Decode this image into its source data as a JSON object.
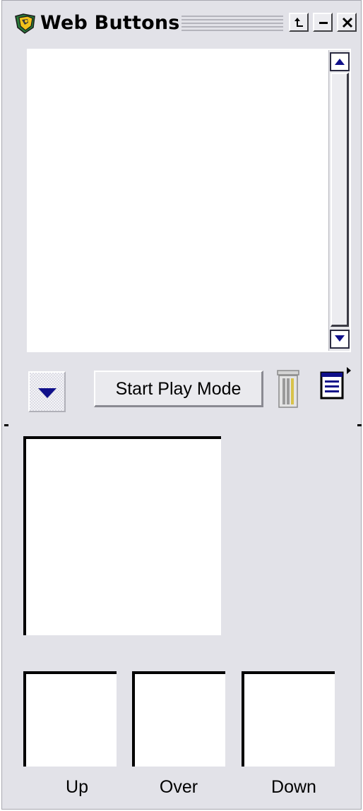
{
  "window": {
    "title": "Web Buttons"
  },
  "toolbar": {
    "play_button_label": "Start Play Mode"
  },
  "states": {
    "up_label": "Up",
    "over_label": "Over",
    "down_label": "Down"
  },
  "colors": {
    "panel_background": "#e2e2e8",
    "arrow_blue": "#10108a"
  },
  "icons": {
    "app": "web-buttons-app-icon",
    "pin": "pin-icon",
    "minimize": "minimize-icon",
    "close": "close-icon",
    "scroll_up": "scroll-up-arrow-icon",
    "scroll_down": "scroll-down-arrow-icon",
    "dropdown": "dropdown-arrow-icon",
    "trash": "trash-icon",
    "menu": "options-menu-icon"
  }
}
